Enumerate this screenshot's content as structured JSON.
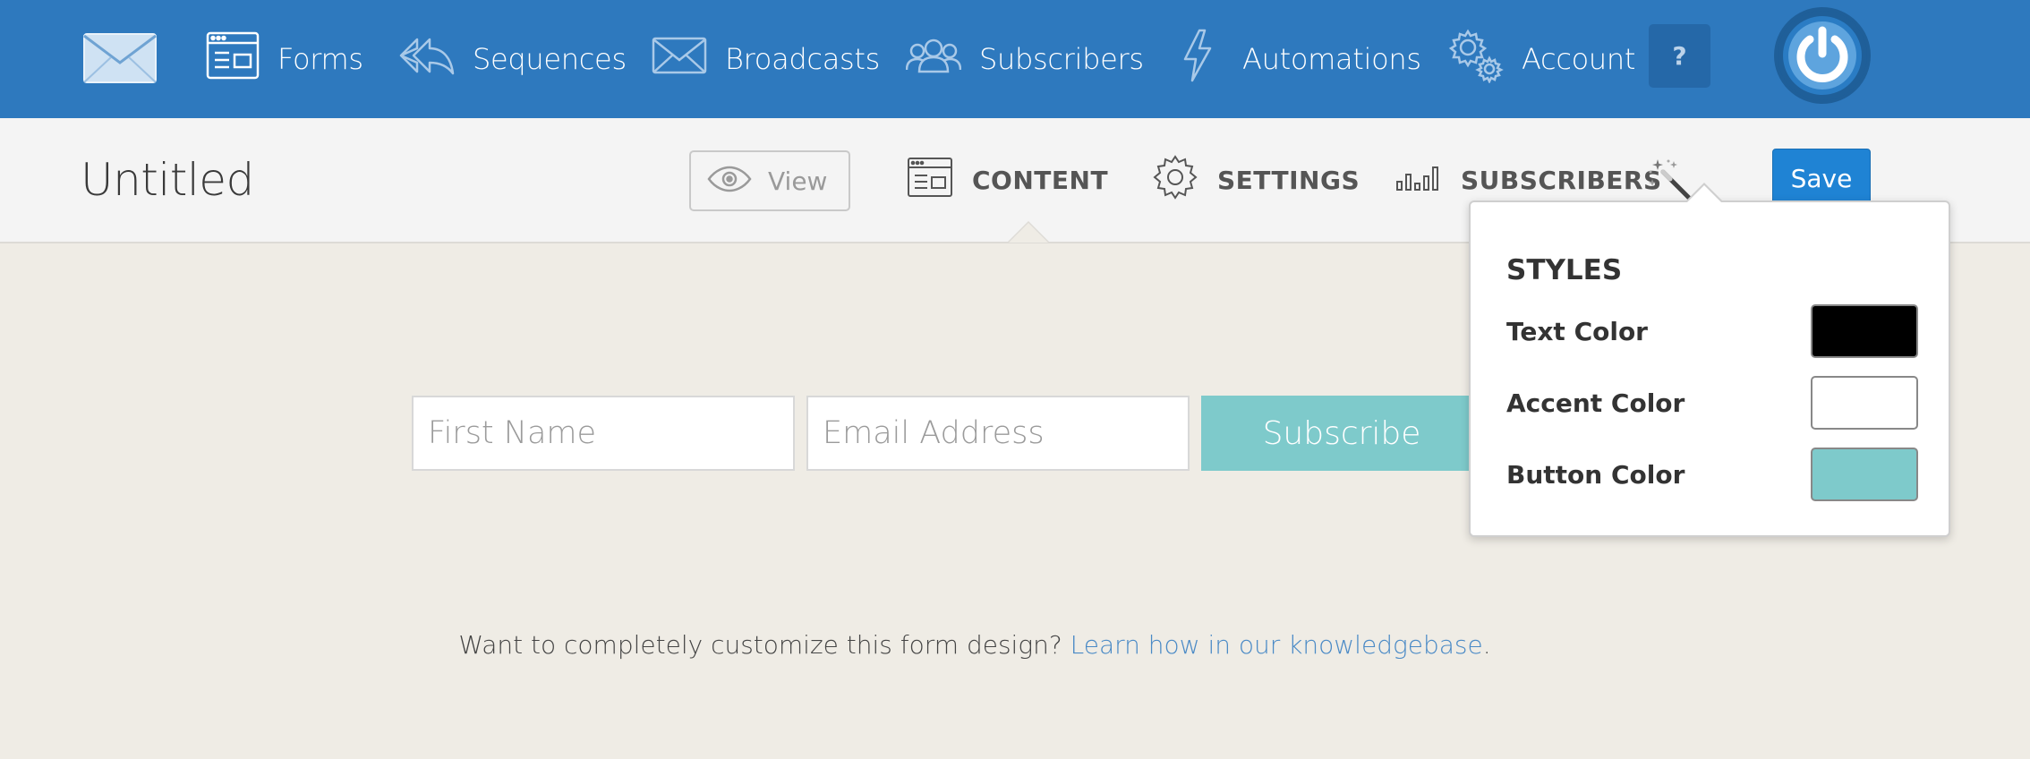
{
  "topnav": {
    "items": [
      {
        "label": "Forms",
        "icon": "forms-icon"
      },
      {
        "label": "Sequences",
        "icon": "reply-all-icon"
      },
      {
        "label": "Broadcasts",
        "icon": "envelope-icon"
      },
      {
        "label": "Subscribers",
        "icon": "users-icon"
      },
      {
        "label": "Automations",
        "icon": "lightning-icon"
      },
      {
        "label": "Account",
        "icon": "gears-icon"
      }
    ],
    "help_label": "?",
    "colors": {
      "bar": "#2e79be",
      "help": "#2568a8"
    }
  },
  "subheader": {
    "title": "Untitled",
    "view_label": "View",
    "tabs": [
      {
        "label": "CONTENT",
        "icon": "forms-icon",
        "active": true
      },
      {
        "label": "SETTINGS",
        "icon": "gear-icon"
      },
      {
        "label": "SUBSCRIBERS",
        "icon": "bar-chart-icon"
      }
    ],
    "save_label": "Save"
  },
  "form": {
    "first_name_placeholder": "First Name",
    "email_placeholder": "Email Address",
    "subscribe_label": "Subscribe",
    "footer_text": "Want to completely customize this form design? ",
    "footer_link": "Learn how in our knowledgebase",
    "footer_end": "."
  },
  "styles_popover": {
    "heading": "STYLES",
    "rows": [
      {
        "label": "Text Color",
        "color": "#000000"
      },
      {
        "label": "Accent Color",
        "color": "#ffffff"
      },
      {
        "label": "Button Color",
        "color": "#7ecacb"
      }
    ]
  }
}
